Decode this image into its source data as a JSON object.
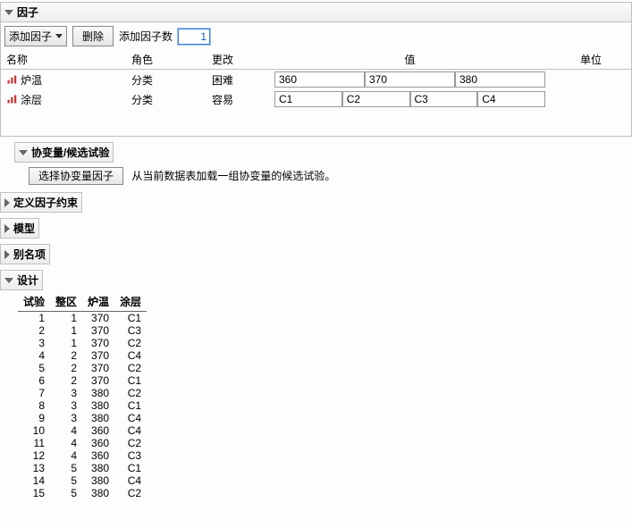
{
  "sections": {
    "factors": "因子",
    "covariate": "协变量/候选试验",
    "constraints": "定义因子约束",
    "model": "模型",
    "alias": "别名项",
    "design": "设计"
  },
  "toolbar": {
    "add_factor": "添加因子",
    "delete": "删除",
    "add_count_label": "添加因子数",
    "add_count_value": "1"
  },
  "factor_headers": {
    "name": "名称",
    "role": "角色",
    "change": "更改",
    "value": "值",
    "unit": "单位"
  },
  "factors": [
    {
      "name": "炉温",
      "role": "分类",
      "change": "困难",
      "levels": [
        "360",
        "370",
        "380"
      ]
    },
    {
      "name": "涂层",
      "role": "分类",
      "change": "容易",
      "levels": [
        "C1",
        "C2",
        "C3",
        "C4"
      ]
    }
  ],
  "covariate": {
    "button": "选择协变量因子",
    "helper": "从当前数据表加载一组协变量的候选试验。"
  },
  "design_headers": {
    "trial": "试验",
    "block": "整区",
    "f1": "炉温",
    "f2": "涂层"
  },
  "design": [
    {
      "trial": 1,
      "block": 1,
      "f1": "370",
      "f2": "C1"
    },
    {
      "trial": 2,
      "block": 1,
      "f1": "370",
      "f2": "C3"
    },
    {
      "trial": 3,
      "block": 1,
      "f1": "370",
      "f2": "C2"
    },
    {
      "trial": 4,
      "block": 2,
      "f1": "370",
      "f2": "C4"
    },
    {
      "trial": 5,
      "block": 2,
      "f1": "370",
      "f2": "C2"
    },
    {
      "trial": 6,
      "block": 2,
      "f1": "370",
      "f2": "C1"
    },
    {
      "trial": 7,
      "block": 3,
      "f1": "380",
      "f2": "C2"
    },
    {
      "trial": 8,
      "block": 3,
      "f1": "380",
      "f2": "C1"
    },
    {
      "trial": 9,
      "block": 3,
      "f1": "380",
      "f2": "C4"
    },
    {
      "trial": 10,
      "block": 4,
      "f1": "360",
      "f2": "C4"
    },
    {
      "trial": 11,
      "block": 4,
      "f1": "360",
      "f2": "C2"
    },
    {
      "trial": 12,
      "block": 4,
      "f1": "360",
      "f2": "C3"
    },
    {
      "trial": 13,
      "block": 5,
      "f1": "380",
      "f2": "C1"
    },
    {
      "trial": 14,
      "block": 5,
      "f1": "380",
      "f2": "C4"
    },
    {
      "trial": 15,
      "block": 5,
      "f1": "380",
      "f2": "C2"
    }
  ]
}
